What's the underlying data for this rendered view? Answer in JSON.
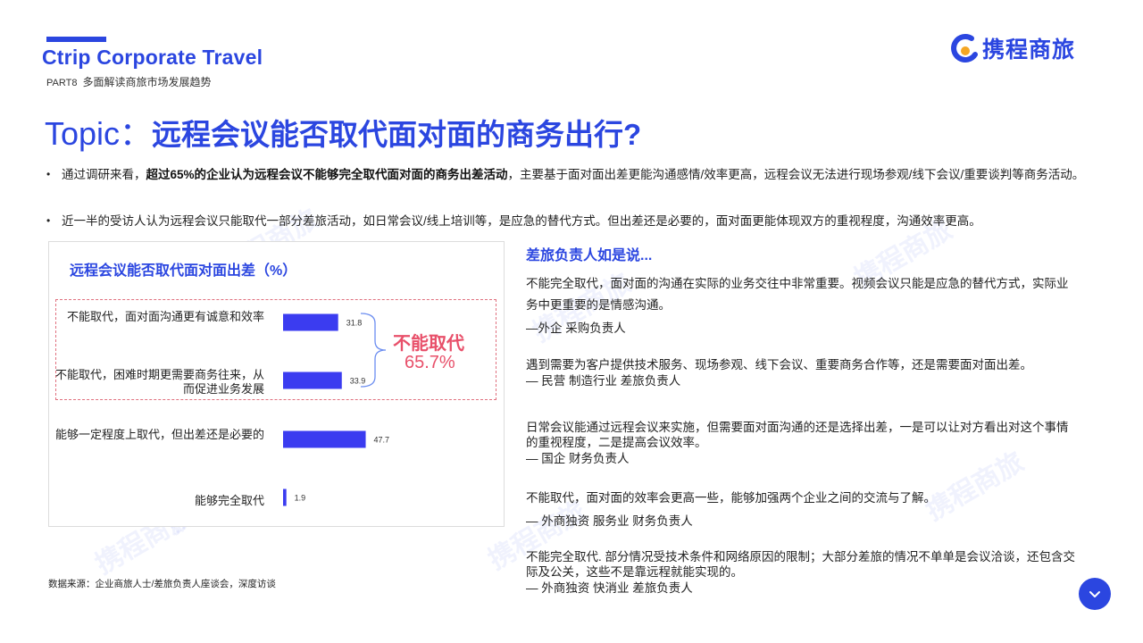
{
  "header": {
    "brand": "Ctrip Corporate Travel",
    "part_code": "PART8",
    "part_title": "多面解读商旅市场发展趋势",
    "logo_text": "携程商旅",
    "accent": "#2b46e0"
  },
  "title": {
    "prefix": "Topic：",
    "main": "远程会议能否取代面对面的商务出行?"
  },
  "bullets": [
    {
      "pre": "通过调研来看，",
      "bold": "超过65%的企业认为远程会议不能够完全取代面对面的商务出差活动",
      "post": "，主要基于面对面出差更能沟通感情/效率更高，远程会议无法进行现场参观/线下会议/重要谈判等商务活动。"
    },
    {
      "pre": "近一半的受访人认为远程会议只能取代一部分差旅活动，如日常会议/线上培训等，是应急的替代方式。但出差还是必要的，面对面更能体现双方的重视程度，沟通效率更高。",
      "bold": "",
      "post": ""
    }
  ],
  "chart_data": {
    "type": "bar",
    "orientation": "horizontal",
    "title": "远程会议能否取代面对面出差（%）",
    "categories": [
      "不能取代，面对面沟通更有诚意和效率",
      "不能取代，困难时期更需要商务往来，从而促进业务发展",
      "能够一定程度上取代，但出差还是必要的",
      "能够完全取代"
    ],
    "values": [
      31.8,
      33.9,
      47.7,
      1.9
    ],
    "value_labels": [
      "31.8",
      "33.9",
      "47.7",
      "1.9"
    ],
    "bar_color": "#3b3cf0",
    "xlim": [
      0,
      100
    ],
    "grid": false,
    "callout": {
      "title": "不能取代",
      "value": "65.7%",
      "color": "#e8506a"
    }
  },
  "quotes": {
    "heading": "差旅负责人如是说...",
    "items": [
      {
        "text": "不能完全取代，面对面的沟通在实际的业务交往中非常重要。视频会议只能是应急的替代方式，实际业务中更重要的是情感沟通。",
        "source": "—外企 采购负责人"
      },
      {
        "text": "遇到需要为客户提供技术服务、现场参观、线下会议、重要商务合作等，还是需要面对面出差。",
        "source": "— 民营 制造行业 差旅负责人"
      },
      {
        "text": "日常会议能通过远程会议来实施，但需要面对面沟通的还是选择出差，一是可以让对方看出对这个事情的重视程度，二是提高会议效率。",
        "source": "— 国企 财务负责人"
      },
      {
        "text": "不能取代，面对面的效率会更高一些，能够加强两个企业之间的交流与了解。",
        "source": "— 外商独资 服务业 财务负责人"
      },
      {
        "text": "不能完全取代. 部分情况受技术条件和网络原因的限制；大部分差旅的情况不单单是会议洽谈，还包含交际及公关，这些不是靠远程就能实现的。",
        "source": "— 外商独资 快消业 差旅负责人"
      }
    ]
  },
  "source_note": "数据来源：企业商旅人士/差旅负责人座谈会，深度访谈",
  "watermark_text": "携程商旅",
  "nav_icon": "chevron-down-icon"
}
